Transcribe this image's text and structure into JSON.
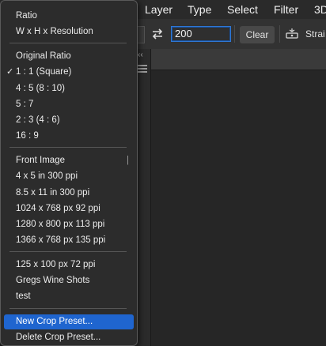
{
  "menubar": {
    "items": [
      "Layer",
      "Type",
      "Select",
      "Filter",
      "3D"
    ]
  },
  "options_bar": {
    "ratio_value": "200",
    "clear_label": "Clear",
    "straighten_label": "Strai"
  },
  "crop_menu": {
    "groups": [
      [
        "Ratio",
        "W x H x Resolution"
      ],
      [
        "Original Ratio",
        "1 : 1 (Square)",
        "4 : 5 (8 : 10)",
        "5 : 7",
        "2 : 3 (4 : 6)",
        "16 : 9"
      ],
      [
        "Front Image",
        "4 x 5 in 300 ppi",
        "8.5 x 11 in 300 ppi",
        "1024 x 768 px 92 ppi",
        "1280 x 800 px 113 ppi",
        "1366 x 768 px 135 ppi"
      ],
      [
        "125 x 100 px 72 ppi",
        "Gregs Wine Shots",
        "test"
      ],
      [
        "New Crop Preset...",
        "Delete Crop Preset..."
      ]
    ],
    "checked_item": "1 : 1 (Square)",
    "highlighted_item": "New Crop Preset...",
    "check_glyph": "✓"
  },
  "icons": {
    "swap": "swap-arrows-icon",
    "straighten": "straighten-level-icon",
    "collapse": "double-chevron-left-icon",
    "panel_menu": "hamburger-icon"
  }
}
